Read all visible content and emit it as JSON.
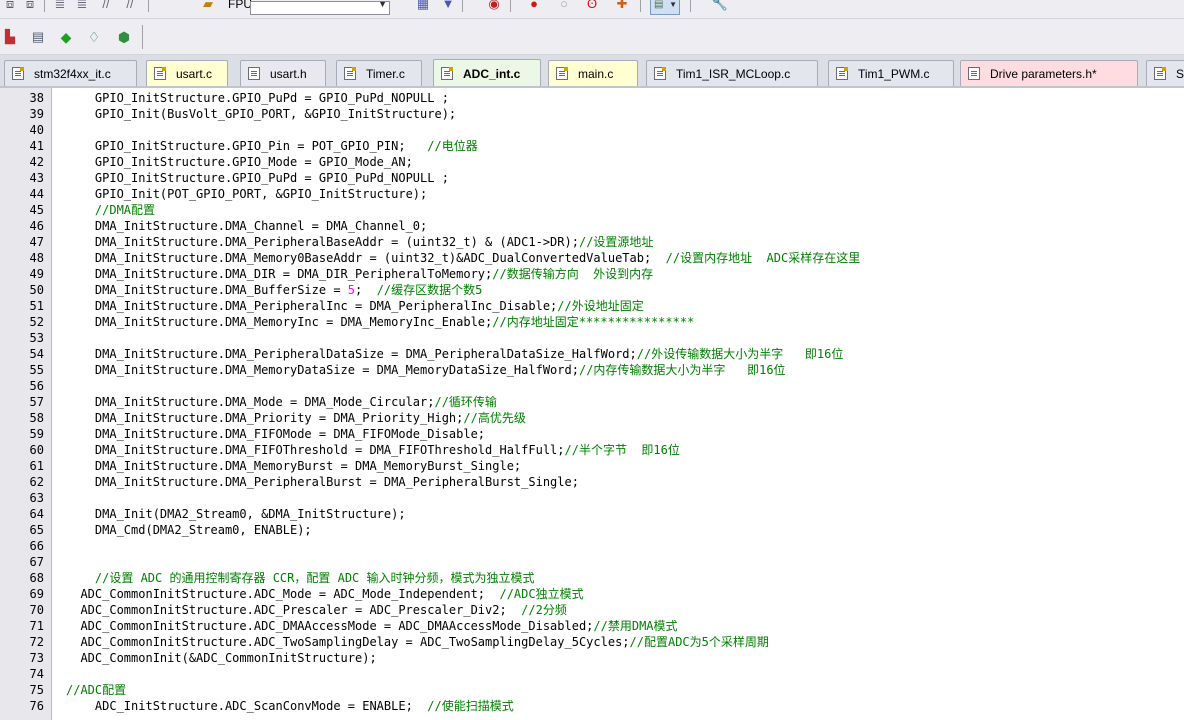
{
  "toolbar": {
    "fpu_label": "FPU",
    "row1_icons": [
      "build-icon",
      "rebuild-icon",
      "indent-icon",
      "unindent-icon",
      "comment-icon",
      "uncomment-icon",
      "config-icon",
      "target-dropdown",
      "save-all-icon",
      "insert-icon",
      "debug-icon",
      "breakpoint-icon",
      "disable-breakpoint-icon",
      "kill-breakpoints-icon",
      "clear-icon",
      "window-dropdown-icon",
      "wrench-icon"
    ],
    "row2_icons": [
      "load-icon",
      "download-icon",
      "green-diamond-icon",
      "batch-icon",
      "manage-icon"
    ]
  },
  "tabs": [
    {
      "label": "stm32f4xx_it.c",
      "bg": "#e4e6ee",
      "active": false
    },
    {
      "label": "usart.c",
      "bg": "#ffffd2",
      "active": false
    },
    {
      "label": "usart.h",
      "bg": "#e8e8ee",
      "active": false
    },
    {
      "label": "Timer.c",
      "bg": "#e4e6ee",
      "active": false
    },
    {
      "label": "ADC_int.c",
      "bg": "#ebf8e6",
      "active": true
    },
    {
      "label": "main.c",
      "bg": "#ffffd2",
      "active": false
    },
    {
      "label": "Tim1_ISR_MCLoop.c",
      "bg": "#e4e6ee",
      "active": false
    },
    {
      "label": "Tim1_PWM.c",
      "bg": "#e4e6ee",
      "active": false
    },
    {
      "label": "Drive parameters.h*",
      "bg": "#ffdce0",
      "active": false
    },
    {
      "label": "S",
      "bg": "#e4e6ee",
      "active": false
    }
  ],
  "colors": {
    "comment": "#008000",
    "number": "#ff00ff",
    "text": "#000000"
  },
  "lines": [
    {
      "n": "38",
      "indent": 4,
      "code": "GPIO_InitStructure.GPIO_PuPd = GPIO_PuPd_NOPULL ;",
      "comment": ""
    },
    {
      "n": "39",
      "indent": 4,
      "code": "GPIO_Init(BusVolt_GPIO_PORT, &GPIO_InitStructure);",
      "comment": ""
    },
    {
      "n": "40",
      "indent": 0,
      "code": "",
      "comment": ""
    },
    {
      "n": "41",
      "indent": 4,
      "code": "GPIO_InitStructure.GPIO_Pin = POT_GPIO_PIN;   ",
      "comment": "//电位器"
    },
    {
      "n": "42",
      "indent": 4,
      "code": "GPIO_InitStructure.GPIO_Mode = GPIO_Mode_AN;",
      "comment": ""
    },
    {
      "n": "43",
      "indent": 4,
      "code": "GPIO_InitStructure.GPIO_PuPd = GPIO_PuPd_NOPULL ;",
      "comment": ""
    },
    {
      "n": "44",
      "indent": 4,
      "code": "GPIO_Init(POT_GPIO_PORT, &GPIO_InitStructure);",
      "comment": ""
    },
    {
      "n": "45",
      "indent": 4,
      "code": "",
      "comment": "//DMA配置"
    },
    {
      "n": "46",
      "indent": 4,
      "code": "DMA_InitStructure.DMA_Channel = DMA_Channel_0;",
      "comment": ""
    },
    {
      "n": "47",
      "indent": 4,
      "code": "DMA_InitStructure.DMA_PeripheralBaseAddr = (uint32_t) & (ADC1->DR);",
      "comment": "//设置源地址"
    },
    {
      "n": "48",
      "indent": 4,
      "code": "DMA_InitStructure.DMA_Memory0BaseAddr = (uint32_t)&ADC_DualConvertedValueTab;  ",
      "comment": "//设置内存地址  ADC采样存在这里"
    },
    {
      "n": "49",
      "indent": 4,
      "code": "DMA_InitStructure.DMA_DIR = DMA_DIR_PeripheralToMemory;",
      "comment": "//数据传输方向  外设到内存"
    },
    {
      "n": "50",
      "indent": 4,
      "code": "DMA_InitStructure.DMA_BufferSize = ",
      "num": "5",
      "code2": ";  ",
      "comment": "//缓存区数据个数5"
    },
    {
      "n": "51",
      "indent": 4,
      "code": "DMA_InitStructure.DMA_PeripheralInc = DMA_PeripheralInc_Disable;",
      "comment": "//外设地址固定"
    },
    {
      "n": "52",
      "indent": 4,
      "code": "DMA_InitStructure.DMA_MemoryInc = DMA_MemoryInc_Enable;",
      "comment": "//内存地址固定****************"
    },
    {
      "n": "53",
      "indent": 0,
      "code": "",
      "comment": ""
    },
    {
      "n": "54",
      "indent": 4,
      "code": "DMA_InitStructure.DMA_PeripheralDataSize = DMA_PeripheralDataSize_HalfWord;",
      "comment": "//外设传输数据大小为半字   即16位"
    },
    {
      "n": "55",
      "indent": 4,
      "code": "DMA_InitStructure.DMA_MemoryDataSize = DMA_MemoryDataSize_HalfWord;",
      "comment": "//内存传输数据大小为半字   即16位"
    },
    {
      "n": "56",
      "indent": 0,
      "code": "",
      "comment": ""
    },
    {
      "n": "57",
      "indent": 4,
      "code": "DMA_InitStructure.DMA_Mode = DMA_Mode_Circular;",
      "comment": "//循环传输"
    },
    {
      "n": "58",
      "indent": 4,
      "code": "DMA_InitStructure.DMA_Priority = DMA_Priority_High;",
      "comment": "//高优先级"
    },
    {
      "n": "59",
      "indent": 4,
      "code": "DMA_InitStructure.DMA_FIFOMode = DMA_FIFOMode_Disable;",
      "comment": ""
    },
    {
      "n": "60",
      "indent": 4,
      "code": "DMA_InitStructure.DMA_FIFOThreshold = DMA_FIFOThreshold_HalfFull;",
      "comment": "//半个字节  即16位"
    },
    {
      "n": "61",
      "indent": 4,
      "code": "DMA_InitStructure.DMA_MemoryBurst = DMA_MemoryBurst_Single;",
      "comment": ""
    },
    {
      "n": "62",
      "indent": 4,
      "code": "DMA_InitStructure.DMA_PeripheralBurst = DMA_PeripheralBurst_Single;",
      "comment": ""
    },
    {
      "n": "63",
      "indent": 0,
      "code": "",
      "comment": ""
    },
    {
      "n": "64",
      "indent": 4,
      "code": "DMA_Init(DMA2_Stream0, &DMA_InitStructure);",
      "comment": ""
    },
    {
      "n": "65",
      "indent": 4,
      "code": "DMA_Cmd(DMA2_Stream0, ENABLE);",
      "comment": ""
    },
    {
      "n": "66",
      "indent": 0,
      "code": "",
      "comment": ""
    },
    {
      "n": "67",
      "indent": 0,
      "code": "",
      "comment": ""
    },
    {
      "n": "68",
      "indent": 4,
      "code": "",
      "comment": "//设置 ADC 的通用控制寄存器 CCR，配置 ADC 输入时钟分频，模式为独立模式"
    },
    {
      "n": "69",
      "indent": 2,
      "code": "ADC_CommonInitStructure.ADC_Mode = ADC_Mode_Independent;  ",
      "comment": "//ADC独立模式"
    },
    {
      "n": "70",
      "indent": 2,
      "code": "ADC_CommonInitStructure.ADC_Prescaler = ADC_Prescaler_Div2;  ",
      "comment": "//2分频"
    },
    {
      "n": "71",
      "indent": 2,
      "code": "ADC_CommonInitStructure.ADC_DMAAccessMode = ADC_DMAAccessMode_Disabled;",
      "comment": "//禁用DMA模式"
    },
    {
      "n": "72",
      "indent": 2,
      "code": "ADC_CommonInitStructure.ADC_TwoSamplingDelay = ADC_TwoSamplingDelay_5Cycles;",
      "comment": "//配置ADC为5个采样周期"
    },
    {
      "n": "73",
      "indent": 2,
      "code": "ADC_CommonInit(&ADC_CommonInitStructure);",
      "comment": ""
    },
    {
      "n": "74",
      "indent": 0,
      "code": "",
      "comment": ""
    },
    {
      "n": "75",
      "indent": 0,
      "code": "",
      "comment": "//ADC配置"
    },
    {
      "n": "76",
      "indent": 4,
      "code": "ADC_InitStructure.ADC_ScanConvMode = ENABLE;  ",
      "comment": "//使能扫描模式"
    }
  ]
}
